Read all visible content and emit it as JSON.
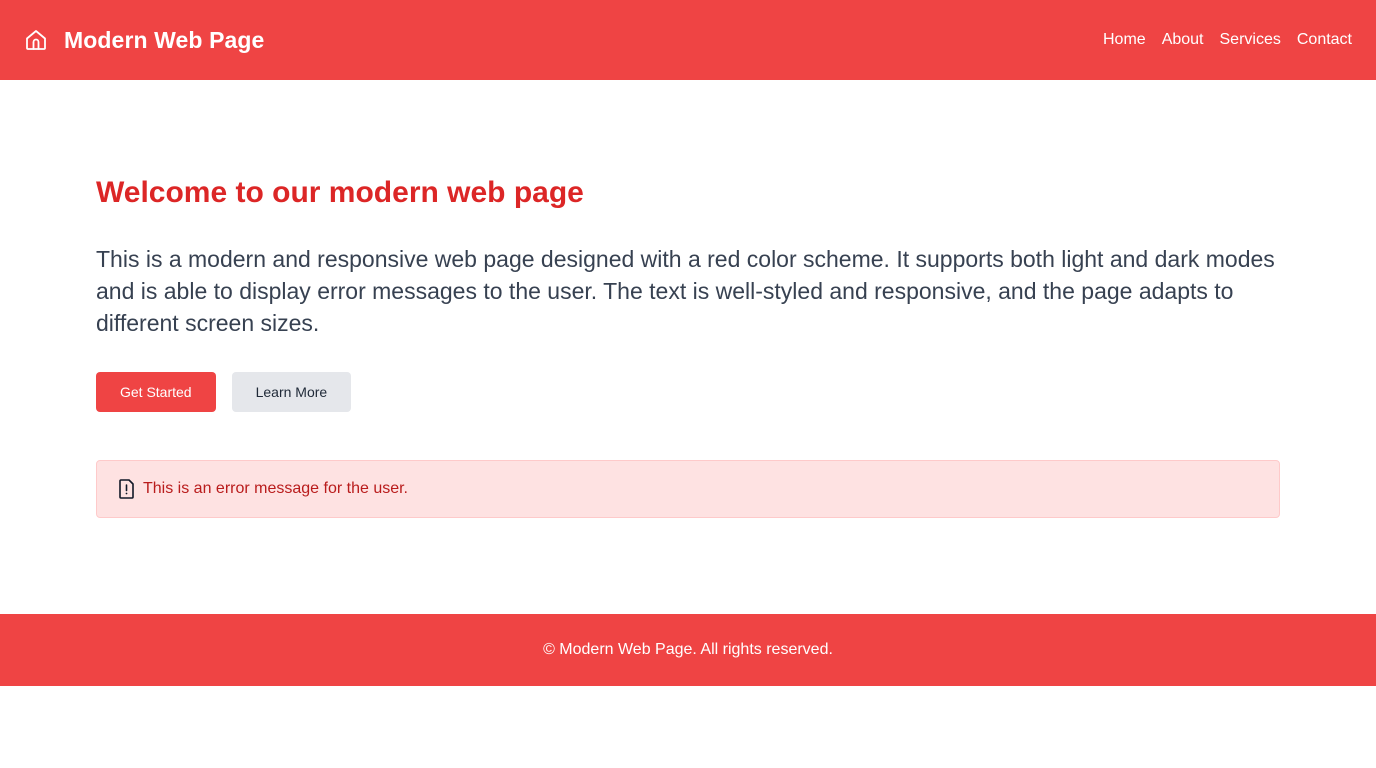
{
  "header": {
    "title": "Modern Web Page",
    "icon": "home-icon",
    "nav": [
      {
        "label": "Home"
      },
      {
        "label": "About"
      },
      {
        "label": "Services"
      },
      {
        "label": "Contact"
      }
    ]
  },
  "hero": {
    "title": "Welcome to our modern web page",
    "text": "This is a modern and responsive web page designed with a red color scheme. It supports both light and dark modes and is able to display error messages to the user. The text is well-styled and responsive, and the page adapts to different screen sizes.",
    "primary_button": "Get Started",
    "secondary_button": "Learn More"
  },
  "error": {
    "icon": "file-alert-icon",
    "message": "This is an error message for the user."
  },
  "footer": {
    "text": "© Modern Web Page. All rights reserved."
  },
  "colors": {
    "accent": "#ef4444",
    "title": "#dc2626",
    "error_bg": "#fee2e2",
    "error_text": "#b91c1c"
  }
}
